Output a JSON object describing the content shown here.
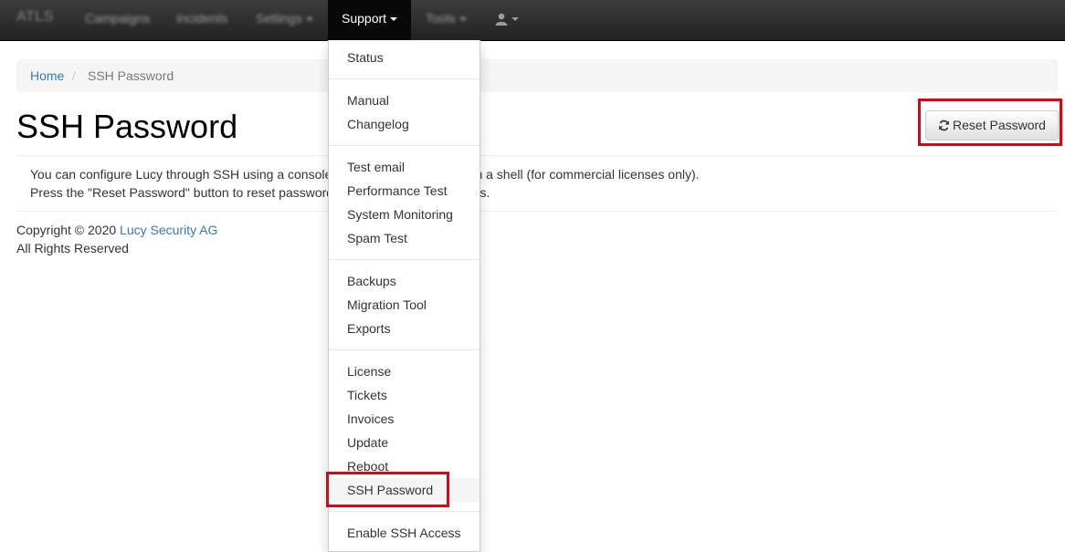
{
  "navbar": {
    "brand": "ATLS",
    "items": [
      {
        "label": "Campaigns"
      },
      {
        "label": "Incidents"
      },
      {
        "label": "Settings"
      },
      {
        "label": "Support"
      },
      {
        "label": "Tools"
      }
    ],
    "user_icon": "user-icon"
  },
  "breadcrumb": {
    "home": "Home",
    "separator": "/",
    "current": "SSH Password"
  },
  "page": {
    "title": "SSH Password",
    "reset_button_label": "Reset Password",
    "reset_button_icon": "refresh-icon",
    "description": "You can configure Lucy through SSH using a console and running commands in a shell (for commercial licenses only). Press the \"Reset Password\" button to reset passwords and view the login details."
  },
  "footer": {
    "copyright": "Copyright © 2020",
    "company": "Lucy Security AG",
    "rights": "All Rights Reserved"
  },
  "support_menu": {
    "groups": [
      [
        "Status"
      ],
      [
        "Manual",
        "Changelog"
      ],
      [
        "Test email",
        "Performance Test",
        "System Monitoring",
        "Spam Test"
      ],
      [
        "Backups",
        "Migration Tool",
        "Exports"
      ],
      [
        "License",
        "Tickets",
        "Invoices",
        "Update",
        "Reboot",
        "SSH Password"
      ],
      [
        "Enable SSH Access"
      ]
    ]
  },
  "colors": {
    "link": "#337ab7",
    "highlight": "#e8000b",
    "navbar": "#222222"
  }
}
